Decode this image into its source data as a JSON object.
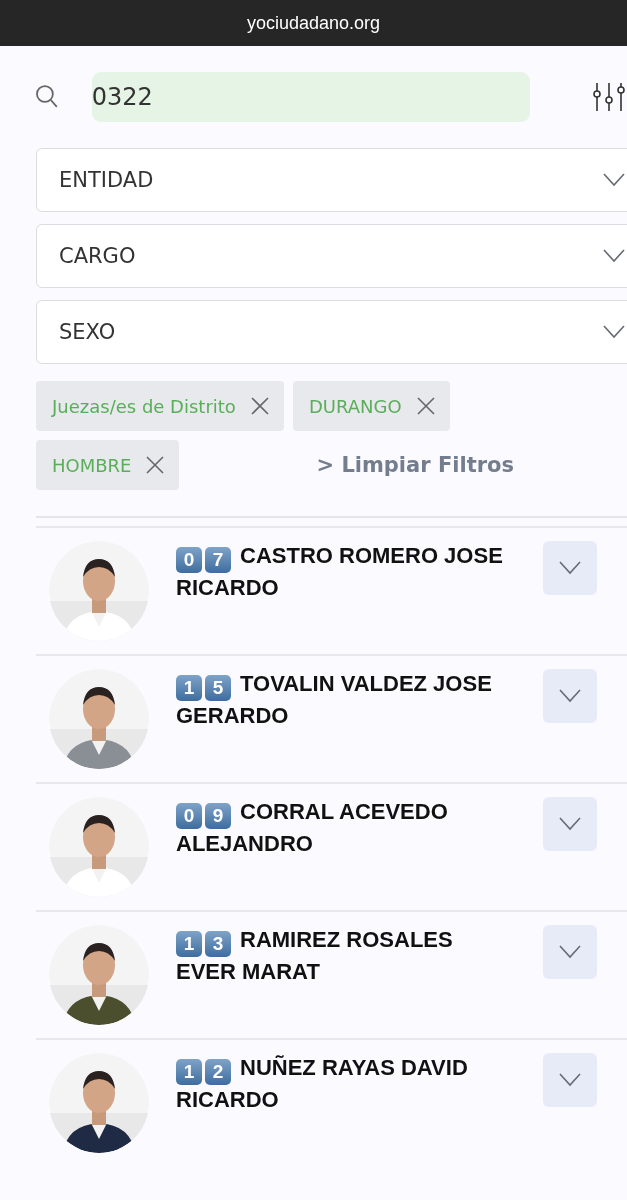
{
  "browser_bar": {
    "url": "yociudadano.org"
  },
  "search": {
    "value": "0322"
  },
  "dropdowns": [
    {
      "label": "ENTIDAD"
    },
    {
      "label": "CARGO"
    },
    {
      "label": "SEXO"
    }
  ],
  "chips": [
    "Juezas/es de Distrito",
    "DURANGO",
    "HOMBRE"
  ],
  "clear_filters": "> Limpiar Filtros",
  "candidates": [
    {
      "keycaps": [
        "0",
        "7"
      ],
      "name": "CASTRO ROMERO JOSE RICARDO",
      "expanded": false
    },
    {
      "keycaps": [
        "1",
        "5"
      ],
      "name": "TOVALIN VALDEZ JOSE GERARDO",
      "expanded": false
    },
    {
      "keycaps": [
        "0",
        "9"
      ],
      "name": "CORRAL ACEVEDO ALEJANDRO",
      "expanded": false
    },
    {
      "keycaps": [
        "1",
        "3"
      ],
      "name": "RAMIREZ ROSALES EVER MARAT",
      "expanded": false
    },
    {
      "keycaps": [
        "1",
        "2"
      ],
      "name": "NUÑEZ RAYAS DAVID RICARDO",
      "expanded": false
    }
  ]
}
